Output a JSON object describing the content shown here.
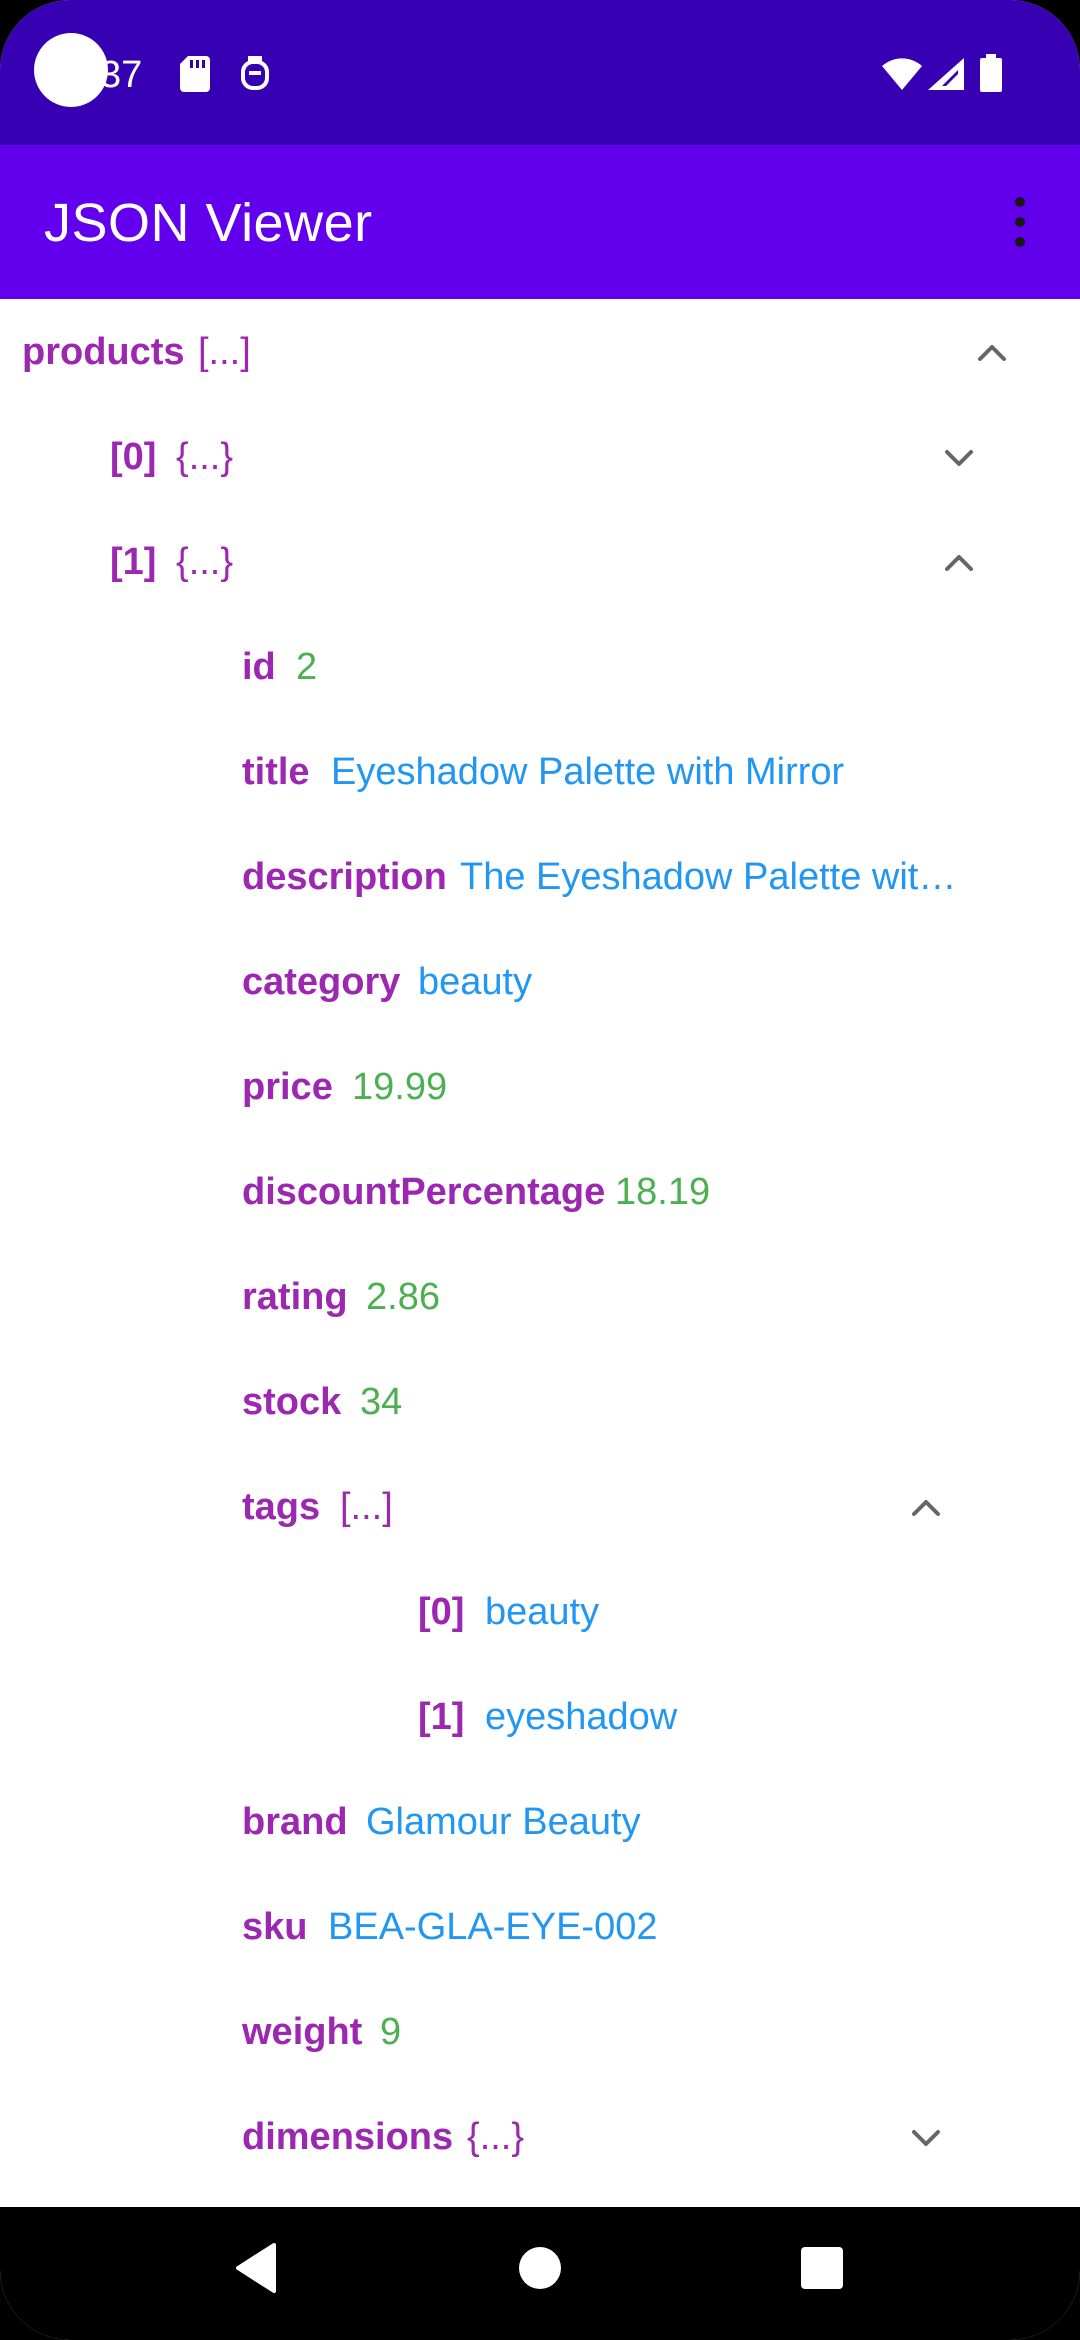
{
  "status_bar": {
    "time": "37",
    "icons": [
      "sd-card-icon",
      "gadget-icon",
      "wifi-icon",
      "cell-signal-icon",
      "battery-icon"
    ]
  },
  "app_bar": {
    "title": "JSON Viewer",
    "menu_icon": "overflow-menu-icon"
  },
  "colors": {
    "status_bar": "#3700B3",
    "app_bar": "#6200EE",
    "key": "#9C27B0",
    "string_value": "#2196F3",
    "number_value": "#4CAF50"
  },
  "tree": {
    "rows": [
      {
        "key": "products",
        "value": "[...]",
        "type": "bracket",
        "expanded": true
      },
      {
        "key": "[0]",
        "value": "{...}",
        "type": "bracket",
        "expanded": false
      },
      {
        "key": "[1]",
        "value": "{...}",
        "type": "bracket",
        "expanded": true
      },
      {
        "key": "id",
        "value": "2",
        "type": "number"
      },
      {
        "key": "title",
        "value": "Eyeshadow Palette with Mirror",
        "type": "string"
      },
      {
        "key": "description",
        "value": "The Eyeshadow Palette wit…",
        "type": "string"
      },
      {
        "key": "category",
        "value": "beauty",
        "type": "string"
      },
      {
        "key": "price",
        "value": "19.99",
        "type": "number"
      },
      {
        "key": "discountPercentage",
        "value": "18.19",
        "type": "number"
      },
      {
        "key": "rating",
        "value": "2.86",
        "type": "number"
      },
      {
        "key": "stock",
        "value": "34",
        "type": "number"
      },
      {
        "key": "tags",
        "value": "[...]",
        "type": "bracket",
        "expanded": true
      },
      {
        "key": "[0]",
        "value": "beauty",
        "type": "string"
      },
      {
        "key": "[1]",
        "value": "eyeshadow",
        "type": "string"
      },
      {
        "key": "brand",
        "value": "Glamour Beauty",
        "type": "string"
      },
      {
        "key": "sku",
        "value": "BEA-GLA-EYE-002",
        "type": "string"
      },
      {
        "key": "weight",
        "value": "9",
        "type": "number"
      },
      {
        "key": "dimensions",
        "value": "{...}",
        "type": "bracket",
        "expanded": false
      }
    ]
  },
  "nav_bar": {
    "buttons": [
      "back-icon",
      "home-icon",
      "recents-icon"
    ]
  }
}
